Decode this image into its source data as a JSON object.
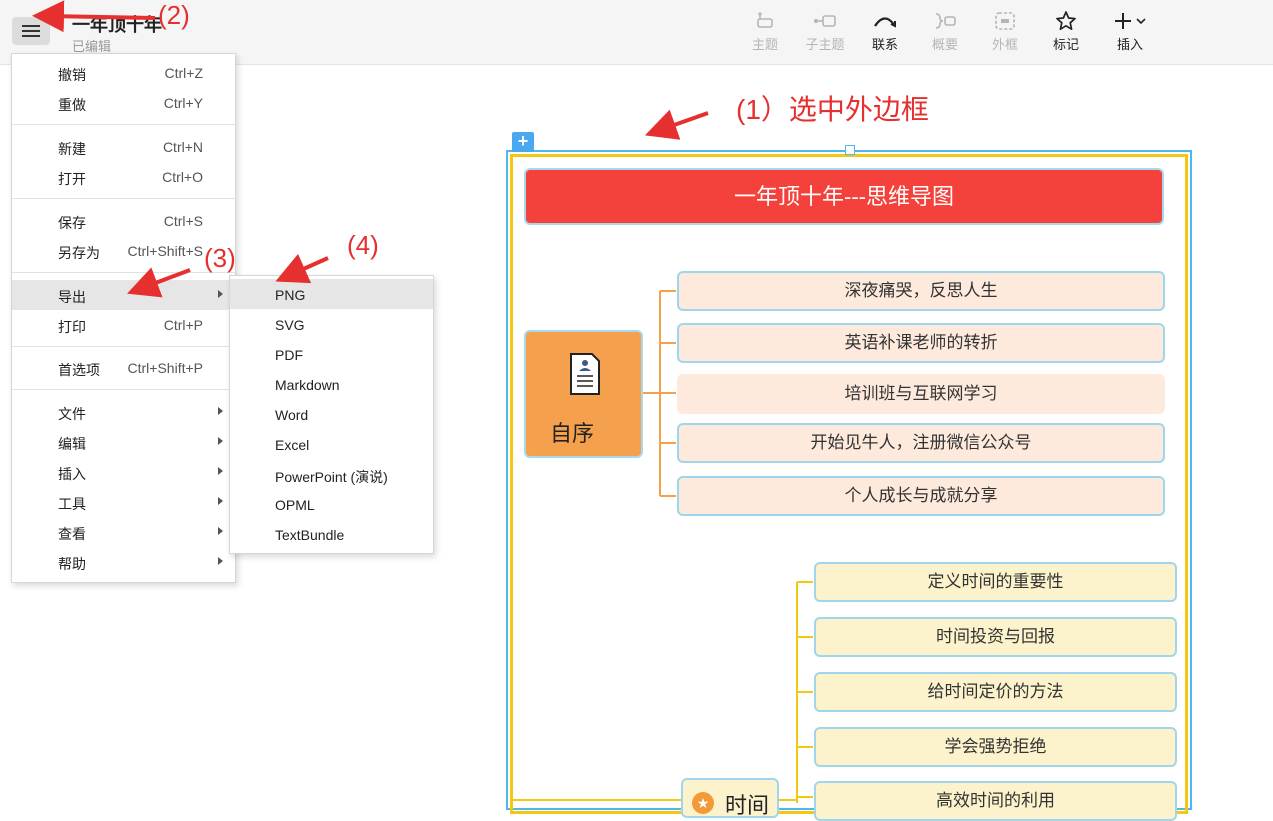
{
  "doc": {
    "title": "一年顶十年",
    "status": "已编辑"
  },
  "toolbar": [
    {
      "name": "topic",
      "label": "主题",
      "enabled": false
    },
    {
      "name": "subtopic",
      "label": "子主题",
      "enabled": false
    },
    {
      "name": "relation",
      "label": "联系",
      "enabled": true
    },
    {
      "name": "summary",
      "label": "概要",
      "enabled": false
    },
    {
      "name": "boundary",
      "label": "外框",
      "enabled": false
    },
    {
      "name": "marker",
      "label": "标记",
      "enabled": true
    },
    {
      "name": "insert",
      "label": "插入",
      "enabled": true
    }
  ],
  "menu": {
    "undo": {
      "label": "撤销",
      "shortcut": "Ctrl+Z"
    },
    "redo": {
      "label": "重做",
      "shortcut": "Ctrl+Y"
    },
    "new": {
      "label": "新建",
      "shortcut": "Ctrl+N"
    },
    "open": {
      "label": "打开",
      "shortcut": "Ctrl+O"
    },
    "save": {
      "label": "保存",
      "shortcut": "Ctrl+S"
    },
    "saveas": {
      "label": "另存为",
      "shortcut": "Ctrl+Shift+S"
    },
    "export": {
      "label": "导出"
    },
    "print": {
      "label": "打印",
      "shortcut": "Ctrl+P"
    },
    "prefs": {
      "label": "首选项",
      "shortcut": "Ctrl+Shift+P"
    },
    "file": {
      "label": "文件"
    },
    "edit": {
      "label": "编辑"
    },
    "insert": {
      "label": "插入"
    },
    "tools": {
      "label": "工具"
    },
    "view": {
      "label": "查看"
    },
    "help": {
      "label": "帮助"
    }
  },
  "export_submenu": [
    "PNG",
    "SVG",
    "PDF",
    "Markdown",
    "Word",
    "Excel",
    "PowerPoint (演说)",
    "OPML",
    "TextBundle"
  ],
  "annotations": {
    "a1": "(1）选中外边框",
    "a2": "(2)",
    "a3": "(3)",
    "a4": "(4)"
  },
  "mindmap": {
    "root": "一年顶十年---思维导图",
    "topic1": {
      "label": "自序",
      "children": [
        "深夜痛哭，反思人生",
        "英语补课老师的转折",
        "培训班与互联网学习",
        "开始见牛人，注册微信公众号",
        "个人成长与成就分享"
      ]
    },
    "topic2": {
      "label": "时间",
      "children": [
        "定义时间的重要性",
        "时间投资与回报",
        "给时间定价的方法",
        "学会强势拒绝",
        "高效时间的利用"
      ]
    }
  },
  "colors": {
    "accent": "#4aa8f0",
    "root_fill": "#f5413b",
    "topic1_fill": "#f4a04c",
    "boundary": "#f2c811",
    "annotation": "#e62f2f"
  }
}
